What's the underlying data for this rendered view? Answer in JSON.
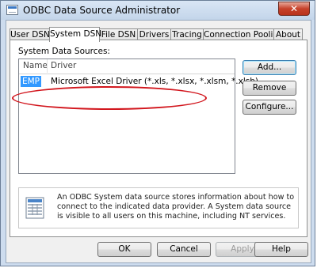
{
  "window": {
    "title": "ODBC Data Source Administrator",
    "close_label": "✕"
  },
  "tabs": [
    {
      "label": "User DSN",
      "active": false
    },
    {
      "label": "System DSN",
      "active": true
    },
    {
      "label": "File DSN",
      "active": false
    },
    {
      "label": "Drivers",
      "active": false
    },
    {
      "label": "Tracing",
      "active": false
    },
    {
      "label": "Connection Pooling",
      "active": false
    },
    {
      "label": "About",
      "active": false
    }
  ],
  "system_dsn": {
    "section_label": "System Data Sources:",
    "columns": {
      "name": "Name",
      "driver": "Driver"
    },
    "rows": [
      {
        "name": "EMP",
        "driver": "Microsoft Excel Driver (*.xls, *.xlsx, *.xlsm, *.xlsb)",
        "selected": true
      }
    ],
    "buttons": {
      "add": "Add...",
      "remove": "Remove",
      "configure": "Configure..."
    },
    "info_text": "An ODBC System data source stores information about how to connect to the indicated data provider.   A System data source is visible to all users on this machine, including NT services."
  },
  "footer": {
    "ok": "OK",
    "cancel": "Cancel",
    "apply": "Apply",
    "help": "Help"
  },
  "colors": {
    "selection": "#3399ff",
    "highlight_annotation": "#d2161d"
  }
}
